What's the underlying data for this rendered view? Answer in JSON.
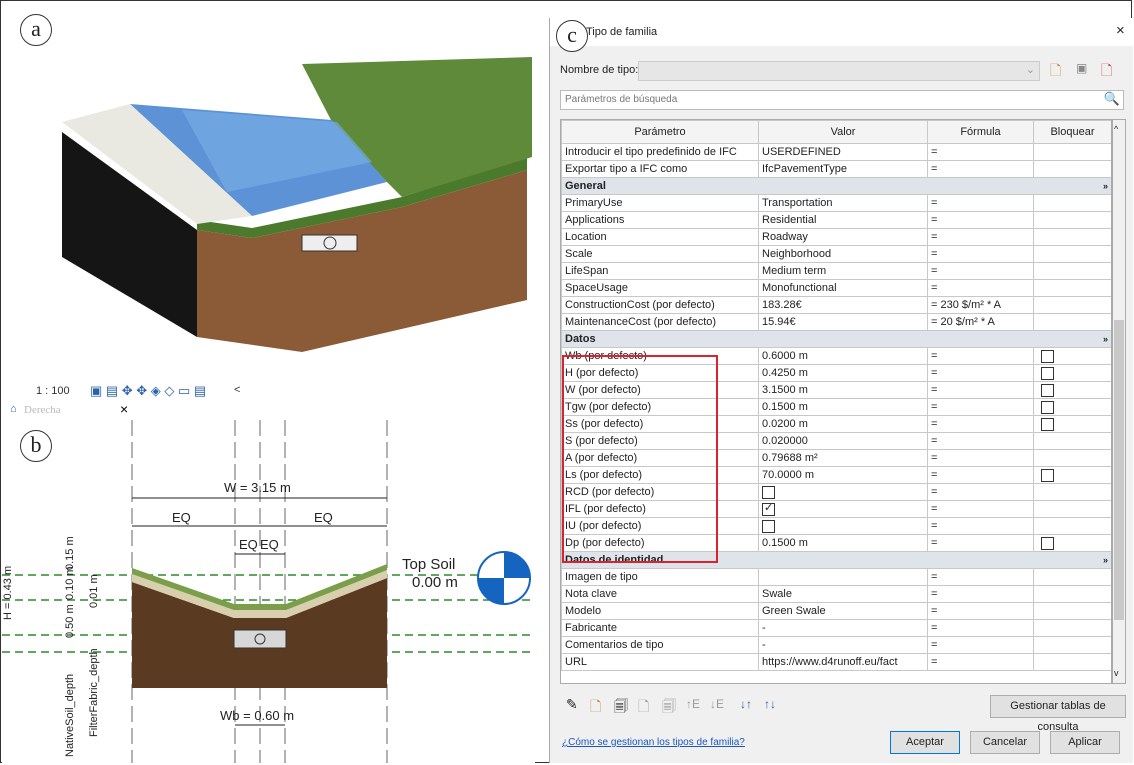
{
  "labels": {
    "a": "a",
    "b": "b",
    "c": "c"
  },
  "view": {
    "scale": "1 : 100",
    "tab_name": "Derecha",
    "tab_close": "×",
    "overflow": "<"
  },
  "drawing": {
    "w": "W = 3.15 m",
    "eq1": "EQ",
    "eq2": "EQ",
    "eq3": "EQ",
    "eq4": "EQ",
    "top_soil": "Top Soil",
    "top_elev": "0.00 m",
    "h": "H = 0.43 m",
    "dim_015": "0.15 m",
    "dim_010": "0.10 m",
    "dim_001": "0.01 m",
    "dim_050": "0.50 m",
    "native": "NativeSoil_depth",
    "filter": "FilterFabric_depth",
    "wb": "Wb = 0.60 m"
  },
  "dialog": {
    "title": "Tipo de familia",
    "close": "×",
    "type_name_label": "Nombre de tipo:",
    "type_name_value": "",
    "search_placeholder": "Parámetros de búsqueda",
    "headers": [
      "Parámetro",
      "Valor",
      "Fórmula",
      "Bloquear"
    ],
    "rows": [
      {
        "p": "Introducir el tipo predefinido de IFC",
        "v": "USERDEFINED",
        "f": "=",
        "lock": "none"
      },
      {
        "p": "Exportar tipo a IFC como",
        "v": "IfcPavementType",
        "f": "=",
        "lock": "none"
      },
      {
        "group": "General"
      },
      {
        "p": "PrimaryUse",
        "v": "Transportation",
        "f": "=",
        "lock": "none"
      },
      {
        "p": "Applications",
        "v": "Residential",
        "f": "=",
        "lock": "none"
      },
      {
        "p": "Location",
        "v": "Roadway",
        "f": "=",
        "lock": "none"
      },
      {
        "p": "Scale",
        "v": "Neighborhood",
        "f": "=",
        "lock": "none"
      },
      {
        "p": "LifeSpan",
        "v": "Medium term",
        "f": "=",
        "lock": "none"
      },
      {
        "p": "SpaceUsage",
        "v": "Monofunctional",
        "f": "=",
        "lock": "none"
      },
      {
        "p": "ConstructionCost (por defecto)",
        "v": "183.28€",
        "f": "= 230 $/m² * A",
        "lock": "none"
      },
      {
        "p": "MaintenanceCost (por defecto)",
        "v": "15.94€",
        "f": "= 20 $/m² * A",
        "lock": "none"
      },
      {
        "group": "Datos"
      },
      {
        "p": "Wb (por defecto)",
        "v": "0.6000 m",
        "f": "=",
        "lock": "off"
      },
      {
        "p": "H (por defecto)",
        "v": "0.4250 m",
        "f": "=",
        "lock": "off"
      },
      {
        "p": "W (por defecto)",
        "v": "3.1500 m",
        "f": "=",
        "lock": "off"
      },
      {
        "p": "Tgw (por defecto)",
        "v": "0.1500 m",
        "f": "=",
        "lock": "off"
      },
      {
        "p": "Ss (por defecto)",
        "v": "0.0200 m",
        "f": "=",
        "lock": "off"
      },
      {
        "p": "S (por defecto)",
        "v": "0.020000",
        "f": "=",
        "lock": "none"
      },
      {
        "p": "A (por defecto)",
        "v": "0.79688 m²",
        "f": "=",
        "lock": "none"
      },
      {
        "p": "Ls (por defecto)",
        "v": "70.0000 m",
        "f": "=",
        "lock": "off"
      },
      {
        "p": "RCD (por defecto)",
        "v": "",
        "vchk": "off",
        "f": "=",
        "lock": "none"
      },
      {
        "p": "IFL (por defecto)",
        "v": "",
        "vchk": "on",
        "f": "=",
        "lock": "none"
      },
      {
        "p": "IU (por defecto)",
        "v": "",
        "vchk": "off",
        "f": "=",
        "lock": "none"
      },
      {
        "p": "Dp (por defecto)",
        "v": "0.1500 m",
        "f": "=",
        "lock": "off"
      },
      {
        "group": "Datos de identidad"
      },
      {
        "p": "Imagen de tipo",
        "v": "",
        "f": "=",
        "lock": "none"
      },
      {
        "p": "Nota clave",
        "v": "Swale",
        "f": "=",
        "lock": "none"
      },
      {
        "p": "Modelo",
        "v": "Green Swale",
        "f": "=",
        "lock": "none"
      },
      {
        "p": "Fabricante",
        "v": "-",
        "f": "=",
        "lock": "none"
      },
      {
        "p": "Comentarios de tipo",
        "v": "-",
        "f": "=",
        "lock": "none"
      },
      {
        "p": "URL",
        "v": "https://www.d4runoff.eu/fact",
        "f": "=",
        "lock": "none"
      }
    ],
    "lookup_button": "Gestionar tablas de consulta",
    "help_link": "¿Cómo se gestionan los tipos de familia?",
    "ok": "Aceptar",
    "cancel": "Cancelar",
    "apply": "Aplicar"
  }
}
